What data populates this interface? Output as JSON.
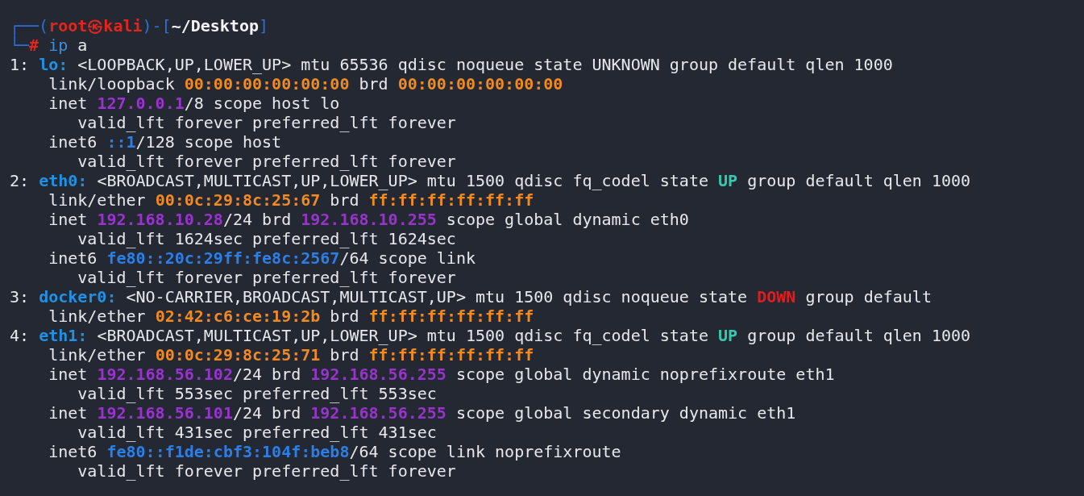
{
  "terminal": {
    "lines": [
      {
        "segments": [
          {
            "kind": "frame",
            "text": "┌──("
          },
          {
            "kind": "user",
            "text": "root㉿kali"
          },
          {
            "kind": "frame",
            "text": ")-["
          },
          {
            "kind": "path",
            "text": "~/Desktop"
          },
          {
            "kind": "frame",
            "text": "]"
          }
        ]
      },
      {
        "segments": [
          {
            "kind": "frame",
            "text": "└─"
          },
          {
            "kind": "hash",
            "text": "#"
          },
          {
            "kind": "cmd",
            "text": " ip"
          },
          {
            "kind": "plain",
            "text": " a"
          }
        ]
      },
      {
        "segments": [
          {
            "kind": "plain",
            "text": "1: "
          },
          {
            "kind": "iface",
            "text": "lo:"
          },
          {
            "kind": "plain",
            "text": " <LOOPBACK,UP,LOWER_UP> mtu 65536 qdisc noqueue state UNKNOWN group default qlen 1000"
          }
        ]
      },
      {
        "segments": [
          {
            "kind": "plain",
            "text": "    link/loopback "
          },
          {
            "kind": "mac",
            "text": "00:00:00:00:00:00"
          },
          {
            "kind": "plain",
            "text": " brd "
          },
          {
            "kind": "mac",
            "text": "00:00:00:00:00:00"
          }
        ]
      },
      {
        "segments": [
          {
            "kind": "plain",
            "text": "    inet "
          },
          {
            "kind": "ip",
            "text": "127.0.0.1"
          },
          {
            "kind": "plain",
            "text": "/8 scope host lo"
          }
        ]
      },
      {
        "segments": [
          {
            "kind": "plain",
            "text": "       valid_lft forever preferred_lft forever"
          }
        ]
      },
      {
        "segments": [
          {
            "kind": "plain",
            "text": "    inet6 "
          },
          {
            "kind": "ipv6",
            "text": "::1"
          },
          {
            "kind": "plain",
            "text": "/128 scope host"
          }
        ]
      },
      {
        "segments": [
          {
            "kind": "plain",
            "text": "       valid_lft forever preferred_lft forever"
          }
        ]
      },
      {
        "segments": [
          {
            "kind": "plain",
            "text": "2: "
          },
          {
            "kind": "iface",
            "text": "eth0:"
          },
          {
            "kind": "plain",
            "text": " <BROADCAST,MULTICAST,UP,LOWER_UP> mtu 1500 qdisc fq_codel state "
          },
          {
            "kind": "up",
            "text": "UP"
          },
          {
            "kind": "plain",
            "text": " group default qlen 1000"
          }
        ]
      },
      {
        "segments": [
          {
            "kind": "plain",
            "text": "    link/ether "
          },
          {
            "kind": "mac",
            "text": "00:0c:29:8c:25:67"
          },
          {
            "kind": "plain",
            "text": " brd "
          },
          {
            "kind": "mac",
            "text": "ff:ff:ff:ff:ff:ff"
          }
        ]
      },
      {
        "segments": [
          {
            "kind": "plain",
            "text": "    inet "
          },
          {
            "kind": "ip",
            "text": "192.168.10.28"
          },
          {
            "kind": "plain",
            "text": "/24 brd "
          },
          {
            "kind": "ip",
            "text": "192.168.10.255"
          },
          {
            "kind": "plain",
            "text": " scope global dynamic eth0"
          }
        ]
      },
      {
        "segments": [
          {
            "kind": "plain",
            "text": "       valid_lft 1624sec preferred_lft 1624sec"
          }
        ]
      },
      {
        "segments": [
          {
            "kind": "plain",
            "text": "    inet6 "
          },
          {
            "kind": "ipv6",
            "text": "fe80::20c:29ff:fe8c:2567"
          },
          {
            "kind": "plain",
            "text": "/64 scope link"
          }
        ]
      },
      {
        "segments": [
          {
            "kind": "plain",
            "text": "       valid_lft forever preferred_lft forever"
          }
        ]
      },
      {
        "segments": [
          {
            "kind": "plain",
            "text": "3: "
          },
          {
            "kind": "iface",
            "text": "docker0:"
          },
          {
            "kind": "plain",
            "text": " <NO-CARRIER,BROADCAST,MULTICAST,UP> mtu 1500 qdisc noqueue state "
          },
          {
            "kind": "down",
            "text": "DOWN"
          },
          {
            "kind": "plain",
            "text": " group default"
          }
        ]
      },
      {
        "segments": [
          {
            "kind": "plain",
            "text": "    link/ether "
          },
          {
            "kind": "mac",
            "text": "02:42:c6:ce:19:2b"
          },
          {
            "kind": "plain",
            "text": " brd "
          },
          {
            "kind": "mac",
            "text": "ff:ff:ff:ff:ff:ff"
          }
        ]
      },
      {
        "segments": [
          {
            "kind": "plain",
            "text": "4: "
          },
          {
            "kind": "iface",
            "text": "eth1:"
          },
          {
            "kind": "plain",
            "text": " <BROADCAST,MULTICAST,UP,LOWER_UP> mtu 1500 qdisc fq_codel state "
          },
          {
            "kind": "up",
            "text": "UP"
          },
          {
            "kind": "plain",
            "text": " group default qlen 1000"
          }
        ]
      },
      {
        "segments": [
          {
            "kind": "plain",
            "text": "    link/ether "
          },
          {
            "kind": "mac",
            "text": "00:0c:29:8c:25:71"
          },
          {
            "kind": "plain",
            "text": " brd "
          },
          {
            "kind": "mac",
            "text": "ff:ff:ff:ff:ff:ff"
          }
        ]
      },
      {
        "segments": [
          {
            "kind": "plain",
            "text": "    inet "
          },
          {
            "kind": "ip",
            "text": "192.168.56.102"
          },
          {
            "kind": "plain",
            "text": "/24 brd "
          },
          {
            "kind": "ip",
            "text": "192.168.56.255"
          },
          {
            "kind": "plain",
            "text": " scope global dynamic noprefixroute eth1"
          }
        ]
      },
      {
        "segments": [
          {
            "kind": "plain",
            "text": "       valid_lft 553sec preferred_lft 553sec"
          }
        ]
      },
      {
        "segments": [
          {
            "kind": "plain",
            "text": "    inet "
          },
          {
            "kind": "ip",
            "text": "192.168.56.101"
          },
          {
            "kind": "plain",
            "text": "/24 brd "
          },
          {
            "kind": "ip",
            "text": "192.168.56.255"
          },
          {
            "kind": "plain",
            "text": " scope global secondary dynamic eth1"
          }
        ]
      },
      {
        "segments": [
          {
            "kind": "plain",
            "text": "       valid_lft 431sec preferred_lft 431sec"
          }
        ]
      },
      {
        "segments": [
          {
            "kind": "plain",
            "text": "    inet6 "
          },
          {
            "kind": "ipv6",
            "text": "fe80::f1de:cbf3:104f:beb8"
          },
          {
            "kind": "plain",
            "text": "/64 scope link noprefixroute"
          }
        ]
      },
      {
        "segments": [
          {
            "kind": "plain",
            "text": "       valid_lft forever preferred_lft forever"
          }
        ]
      }
    ]
  }
}
